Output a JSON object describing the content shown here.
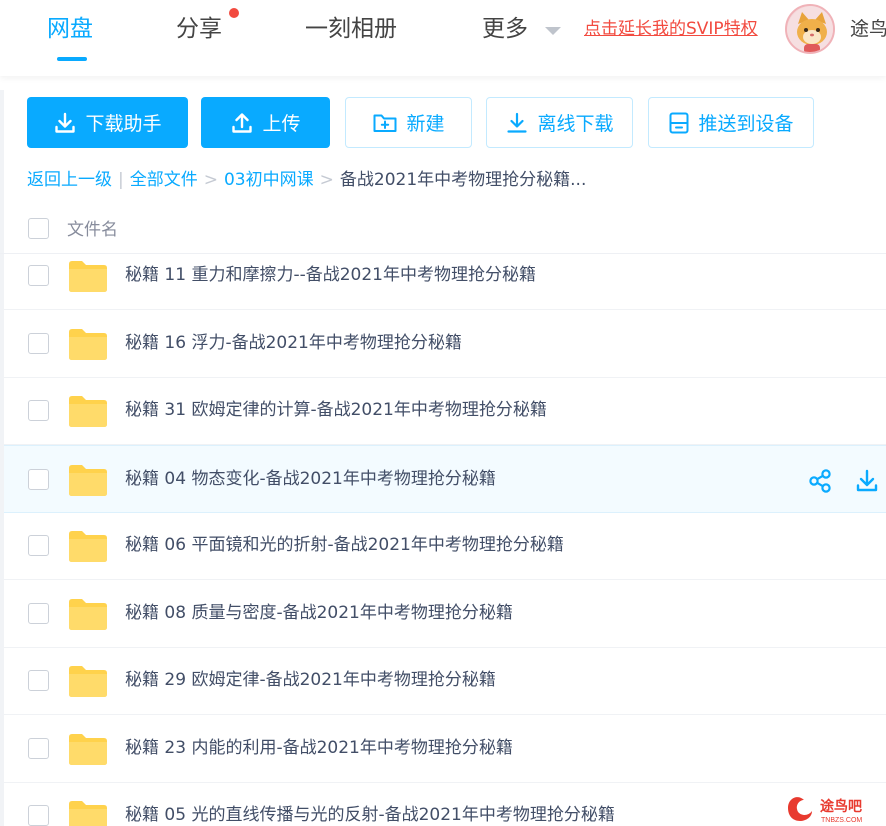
{
  "nav": {
    "tabs": [
      {
        "label": "网盘",
        "active": true
      },
      {
        "label": "分享",
        "has_dot": true
      },
      {
        "label": "一刻相册"
      },
      {
        "label": "更多"
      }
    ],
    "svip_link": "点击延长我的SVIP特权",
    "username": "途鸟"
  },
  "toolbar": {
    "download_helper": "下载助手",
    "upload": "上传",
    "new": "新建",
    "offline_download": "离线下载",
    "push_to_device": "推送到设备"
  },
  "breadcrumb": {
    "back": "返回上一级",
    "separator": "|",
    "all_files": "全部文件",
    "arrow": ">",
    "folder": "03初中网课",
    "current": "备战2021年中考物理抢分秘籍..."
  },
  "list": {
    "header_label": "文件名",
    "rows": [
      {
        "name": "秘籍 11 重力和摩擦力--备战2021年中考物理抢分秘籍",
        "type": "folder"
      },
      {
        "name": "秘籍 16 浮力-备战2021年中考物理抢分秘籍",
        "type": "folder"
      },
      {
        "name": "秘籍 31 欧姆定律的计算-备战2021年中考物理抢分秘籍",
        "type": "folder"
      },
      {
        "name": "秘籍 04 物态变化-备战2021年中考物理抢分秘籍",
        "type": "folder",
        "hovered": true
      },
      {
        "name": "秘籍 06 平面镜和光的折射-备战2021年中考物理抢分秘籍",
        "type": "folder"
      },
      {
        "name": "秘籍 08 质量与密度-备战2021年中考物理抢分秘籍",
        "type": "folder"
      },
      {
        "name": "秘籍 29 欧姆定律-备战2021年中考物理抢分秘籍",
        "type": "folder"
      },
      {
        "name": "秘籍 23 内能的利用-备战2021年中考物理抢分秘籍",
        "type": "folder"
      },
      {
        "name": "秘籍 05 光的直线传播与光的反射-备战2021年中考物理抢分秘籍",
        "type": "folder"
      }
    ]
  },
  "watermark": {
    "text": "途鸟吧",
    "sub": "TNBZS.COM"
  },
  "colors": {
    "accent": "#09AAFF",
    "svip_red": "#f24a3f",
    "folder_yellow": "#FFD24C",
    "row_hover": "#f3fbff"
  }
}
